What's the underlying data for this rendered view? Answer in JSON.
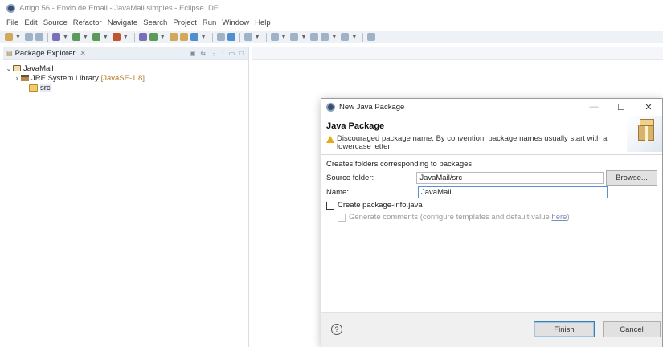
{
  "window": {
    "title": "Artigo 56 - Envio de Email - JavaMail simples - Eclipse IDE"
  },
  "menu": [
    "File",
    "Edit",
    "Source",
    "Refactor",
    "Navigate",
    "Search",
    "Project",
    "Run",
    "Window",
    "Help"
  ],
  "package_explorer": {
    "tab_label": "Package Explorer",
    "close_glyph": "✕",
    "tree": {
      "project": "JavaMail",
      "library": "JRE System Library",
      "library_version": "[JavaSE-1.8]",
      "src": "src"
    }
  },
  "dialog": {
    "title": "New Java Package",
    "heading": "Java Package",
    "warning": "Discouraged package name. By convention, package names usually start with a lowercase letter",
    "description": "Creates folders corresponding to packages.",
    "source_folder_label": "Source folder:",
    "source_folder_value": "JavaMail/src",
    "browse_label": "Browse...",
    "name_label": "Name:",
    "name_value": "JavaMail",
    "create_info_label": "Create package-info.java",
    "generate_comments_label": "Generate comments (configure templates and default value",
    "here_link": "here",
    "close_paren": ")",
    "help_glyph": "?",
    "finish_label": "Finish",
    "cancel_label": "Cancel"
  },
  "colors": {
    "accent": "#3c7fb1",
    "warning": "#e9a81c",
    "library_version": "#b47a2a"
  }
}
